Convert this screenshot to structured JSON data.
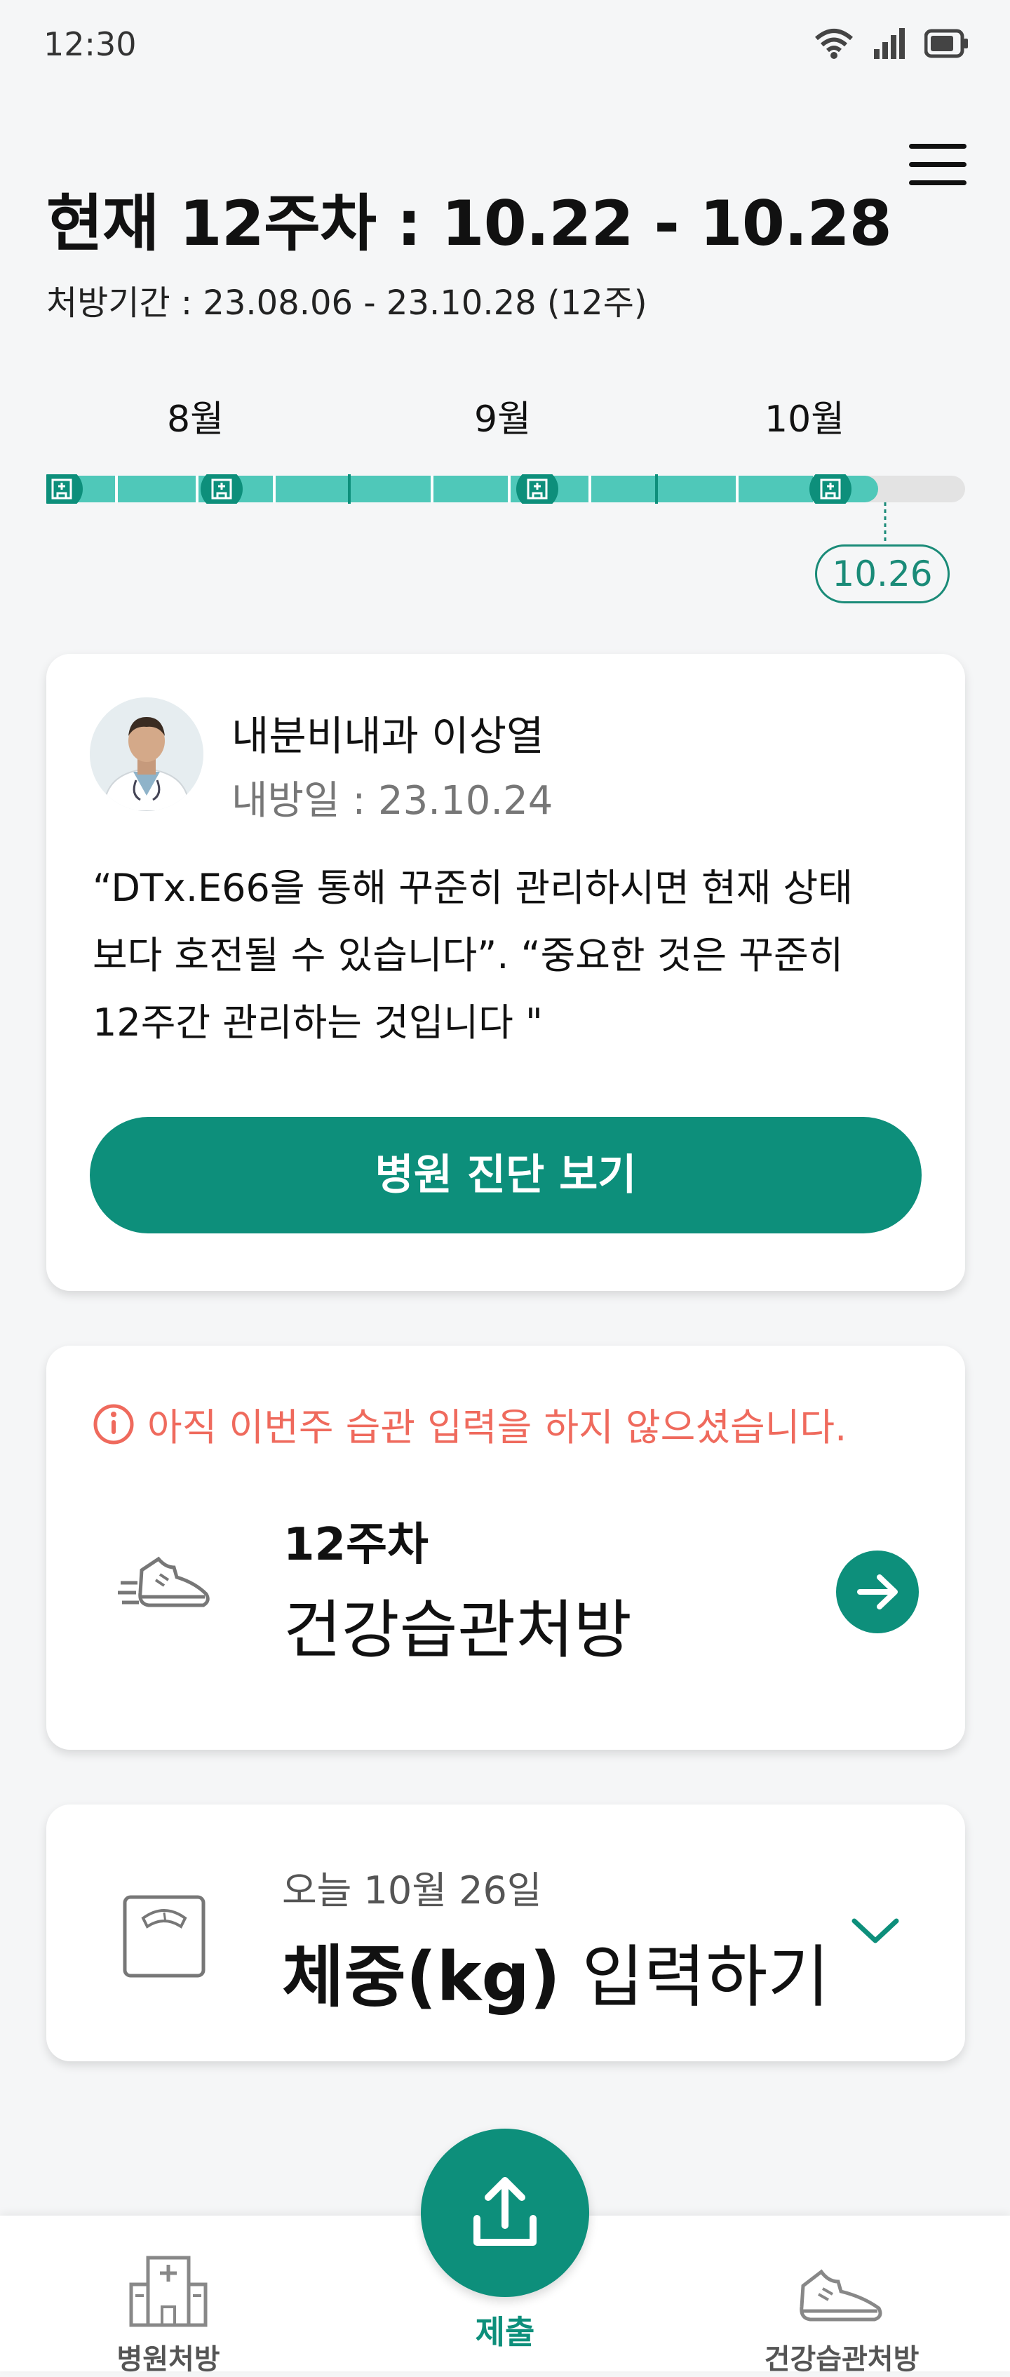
{
  "status_bar": {
    "time": "12:30",
    "icons": [
      "wifi-icon",
      "signal-icon",
      "battery-icon"
    ]
  },
  "header": {
    "title": "현재 12주차 : 10.22 - 10.28",
    "period": "처방기간 : 23.08.06 - 23.10.28 (12주)",
    "menu_icon": "hamburger-menu-icon"
  },
  "timeline": {
    "months": [
      "8월",
      "9월",
      "10월"
    ],
    "current_date": "10.26",
    "progress_fraction": 0.905,
    "hospital_markers": 4,
    "colors": {
      "filled": "#4fc8b9",
      "empty": "#e3e3e3",
      "marker": "#0d8f7b"
    }
  },
  "doctor_card": {
    "name": "내분비내과 이상열",
    "visit_date": "내방일 : 23.10.24",
    "message_lines": [
      "“DTx.E66을 통해 꾸준히 관리하시면 현재 상태",
      "보다 호전될 수 있습니다”. “중요한 것은 꾸준히",
      "12주간 관리하는 것입니다 \""
    ],
    "button_label": "병원 진단 보기"
  },
  "habit_card": {
    "warning": "아직 이번주 습관 입력을 하지 않으셨습니다.",
    "week": "12주차",
    "title": "건강습관처방",
    "icon": "shoe-icon"
  },
  "weight_card": {
    "date": "오늘 10월 26일",
    "title_bold": "체중(kg)",
    "title_rest": " 입력하기",
    "icon": "scale-icon"
  },
  "bottom_nav": {
    "items": [
      {
        "label": "병원처방",
        "icon": "hospital-icon"
      },
      {
        "label": "제출",
        "icon": "upload-icon"
      },
      {
        "label": "건강습관처방",
        "icon": "shoe-icon"
      }
    ]
  },
  "colors": {
    "accent": "#0d8f7b",
    "warning": "#ef6a5d"
  }
}
